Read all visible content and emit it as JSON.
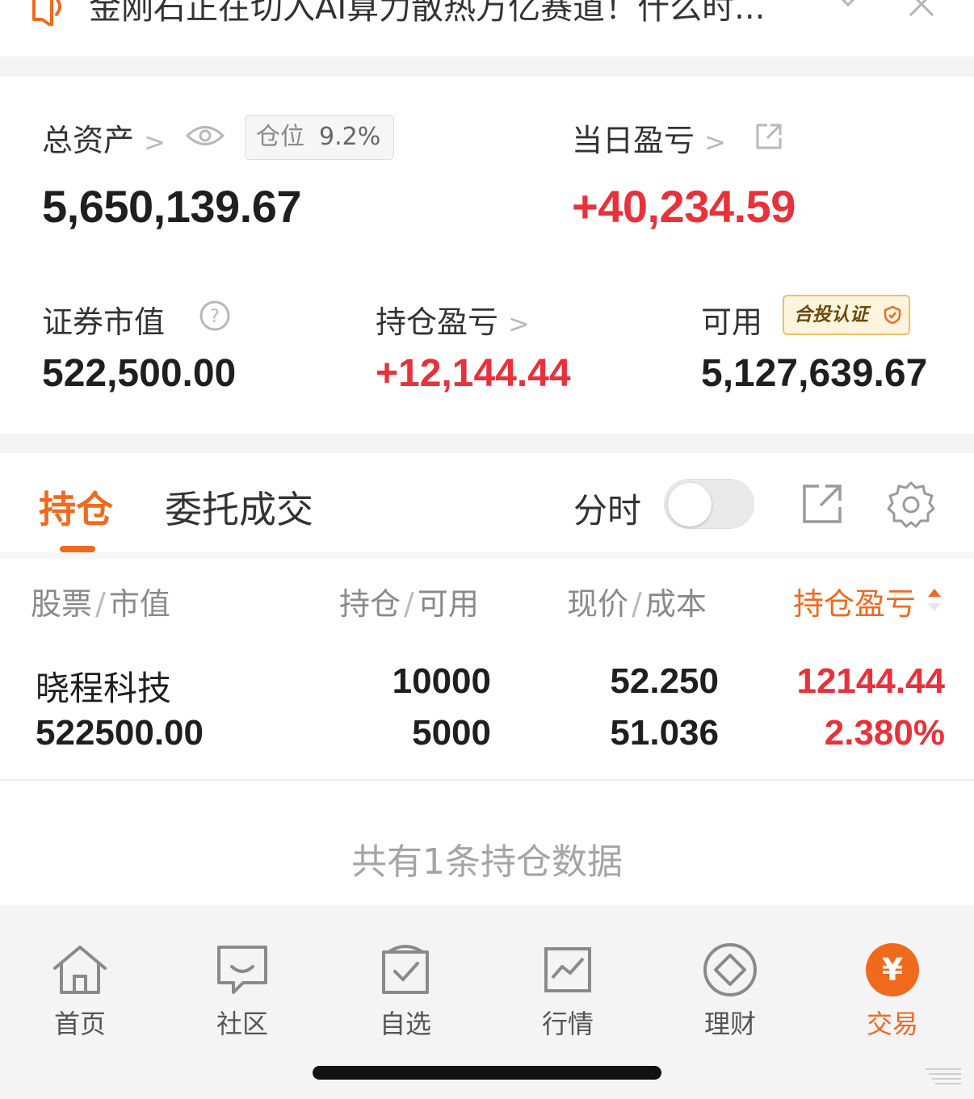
{
  "notice": {
    "text": "金刚石正在切入AI算力散热万亿赛道！什么时..."
  },
  "assets": {
    "total_label": "总资产",
    "position_ratio_label": "仓位",
    "position_ratio_value": "9.2%",
    "total_value": "5,650,139.67",
    "daily_pnl_label": "当日盈亏",
    "daily_pnl_value": "+40,234.59",
    "market_value_label": "证券市值",
    "market_value": "522,500.00",
    "holding_pnl_label": "持仓盈亏",
    "holding_pnl_value": "+12,144.44",
    "available_label": "可用",
    "available_badge": "合投认证",
    "available_value": "5,127,639.67"
  },
  "panel": {
    "tab_holdings": "持仓",
    "tab_orders": "委托成交",
    "timeshare_label": "分时",
    "columns": {
      "stock": "股票",
      "market_value": "市值",
      "holding": "持仓",
      "available": "可用",
      "price": "现价",
      "cost": "成本",
      "pnl": "持仓盈亏"
    },
    "rows": [
      {
        "name": "晓程科技",
        "market_value": "522500.00",
        "holding": "10000",
        "available": "5000",
        "price": "52.250",
        "cost": "51.036",
        "pnl": "12144.44",
        "pnl_pct": "2.380%"
      }
    ],
    "footer": "共有1条持仓数据"
  },
  "nav": {
    "items": [
      {
        "label": "首页",
        "icon": "home-icon"
      },
      {
        "label": "社区",
        "icon": "chat-icon"
      },
      {
        "label": "自选",
        "icon": "watchlist-icon"
      },
      {
        "label": "行情",
        "icon": "chart-icon"
      },
      {
        "label": "理财",
        "icon": "diamond-icon"
      },
      {
        "label": "交易",
        "icon": "yuan-icon"
      }
    ],
    "trade_glyph": "¥"
  },
  "colors": {
    "accent": "#f06a1e",
    "profit_red": "#e8313a"
  }
}
